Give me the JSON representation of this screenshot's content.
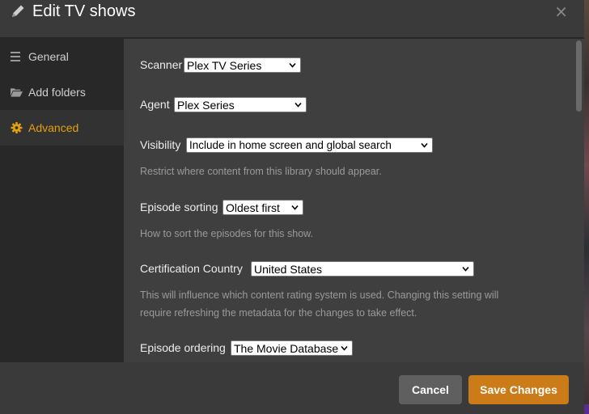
{
  "modal": {
    "title": "Edit TV shows",
    "close_label": "×"
  },
  "sidebar": {
    "items": [
      {
        "label": "General",
        "icon": "list-icon",
        "active": false
      },
      {
        "label": "Add folders",
        "icon": "folder-open-icon",
        "active": false
      },
      {
        "label": "Advanced",
        "icon": "gear-icon",
        "active": true
      }
    ]
  },
  "fields": {
    "scanner": {
      "label": "Scanner",
      "value": "Plex TV Series"
    },
    "agent": {
      "label": "Agent",
      "value": "Plex Series"
    },
    "visibility": {
      "label": "Visibility",
      "value": "Include in home screen and global search",
      "help": "Restrict where content from this library should appear."
    },
    "episode_sorting": {
      "label": "Episode sorting",
      "value": "Oldest first",
      "help": "How to sort the episodes for this show."
    },
    "certification_country": {
      "label": "Certification Country",
      "value": "United States",
      "help_line1": "This will influence which content rating system is used. Changing this setting will",
      "help_line2": "require refreshing the metadata for the changes to take effect."
    },
    "episode_ordering": {
      "label": "Episode ordering",
      "value": "The Movie Database"
    }
  },
  "footer": {
    "cancel_label": "Cancel",
    "save_label": "Save Changes"
  },
  "colors": {
    "accent": "#e5a00d",
    "save_button": "#cc7b19",
    "cancel_button": "#5f5f5f"
  }
}
